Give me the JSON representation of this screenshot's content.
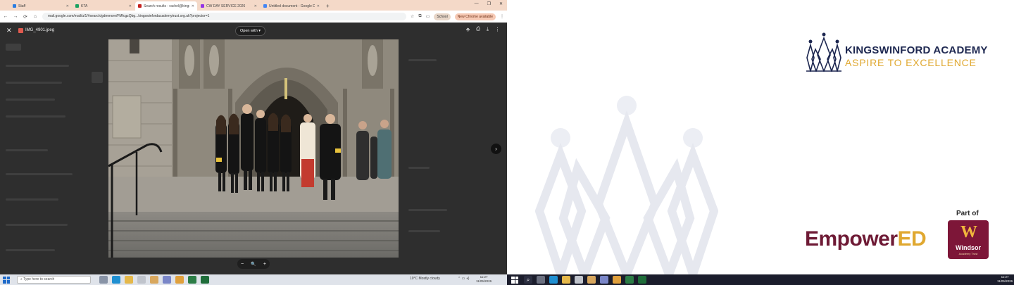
{
  "browser": {
    "tabs": [
      {
        "label": "Staff",
        "color": "#2a7de1",
        "active": false
      },
      {
        "label": "KTA",
        "color": "#1aa260",
        "active": false
      },
      {
        "label": "Search results - rachel@kingswi",
        "color": "#c5221f",
        "active": true
      },
      {
        "label": "CW DAY SERVICE 2026",
        "color": "#9334e6",
        "active": false
      },
      {
        "label": "Untitled document - Google Do",
        "color": "#4285f4",
        "active": false
      }
    ],
    "new_tab": "+",
    "window_controls": [
      "—",
      "❐",
      "✕"
    ],
    "url": "mail.google.com/mail/u/1/#search/gdmmore/FMfcgzQbg...kingswinfordacademytrust.org.uk?projector=1",
    "school_pill": "School",
    "update_pill": "New Chrome available"
  },
  "viewer": {
    "file_name": "IMG_4901.jpeg",
    "open_with_label": "Open with",
    "icons": [
      "add-to-drive",
      "print",
      "download",
      "more"
    ],
    "zoom_out": "−",
    "zoom_icon": "🔍",
    "zoom_in": "+",
    "next": "›"
  },
  "taskbar_left": {
    "search_placeholder": "Type here to search",
    "weather": "10°C  Mostly cloudy",
    "time": "11:27",
    "date": "11/05/2026"
  },
  "slide": {
    "academy_name": "KINGSWINFORD ACADEMY",
    "motto": "ASPIRE TO EXCELLENCE",
    "part_of": "Part of",
    "empower": "Empower",
    "empower_ed": "ED",
    "windsor_letter": "W",
    "windsor_name": "Windsor",
    "windsor_sub": "Academy Trust",
    "colors": {
      "navy": "#1d2750",
      "gold": "#e0a830",
      "maroon": "#6e1a35"
    }
  },
  "taskbar_right": {
    "time": "11:27",
    "date": "11/05/2026"
  }
}
